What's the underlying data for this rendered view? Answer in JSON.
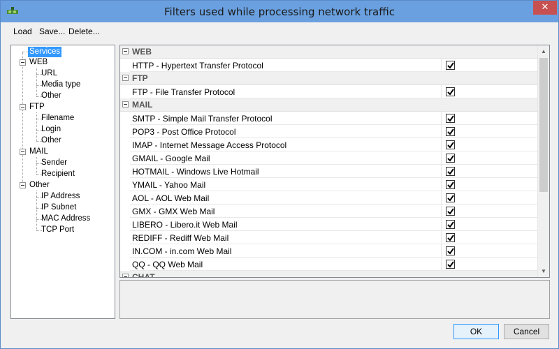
{
  "window": {
    "title": "Filters used while processing network traffic",
    "close_glyph": "✕"
  },
  "menu": {
    "load": "Load",
    "save": "Save...",
    "delete": "Delete..."
  },
  "tree": {
    "services": "Services",
    "web": {
      "label": "WEB",
      "children": [
        "URL",
        "Media type",
        "Other"
      ]
    },
    "ftp": {
      "label": "FTP",
      "children": [
        "Filename",
        "Login",
        "Other"
      ]
    },
    "mail": {
      "label": "MAIL",
      "children": [
        "Sender",
        "Recipient"
      ]
    },
    "other": {
      "label": "Other",
      "children": [
        "IP Address",
        "IP Subnet",
        "MAC Address",
        "TCP Port"
      ]
    }
  },
  "sections": [
    {
      "name": "WEB",
      "rows": [
        {
          "label": "HTTP - Hypertext Transfer Protocol",
          "checked": true
        }
      ]
    },
    {
      "name": "FTP",
      "rows": [
        {
          "label": "FTP - File Transfer Protocol",
          "checked": true
        }
      ]
    },
    {
      "name": "MAIL",
      "rows": [
        {
          "label": "SMTP - Simple Mail Transfer Protocol",
          "checked": true
        },
        {
          "label": "POP3 - Post Office Protocol",
          "checked": true
        },
        {
          "label": "IMAP - Internet Message Access Protocol",
          "checked": true
        },
        {
          "label": "GMAIL - Google Mail",
          "checked": true
        },
        {
          "label": "HOTMAIL - Windows Live Hotmail",
          "checked": true
        },
        {
          "label": "YMAIL - Yahoo Mail",
          "checked": true
        },
        {
          "label": "AOL - AOL Web Mail",
          "checked": true
        },
        {
          "label": "GMX - GMX Web Mail",
          "checked": true
        },
        {
          "label": "LIBERO - Libero.it Web Mail",
          "checked": true
        },
        {
          "label": "REDIFF - Rediff Web Mail",
          "checked": true
        },
        {
          "label": "IN.COM - in.com Web Mail",
          "checked": true
        },
        {
          "label": "QQ - QQ Web Mail",
          "checked": true
        }
      ]
    },
    {
      "name": "CHAT",
      "rows": []
    }
  ],
  "buttons": {
    "ok": "OK",
    "cancel": "Cancel"
  },
  "colors": {
    "titlebar": "#6aa0df",
    "selection": "#3399ff",
    "close": "#c75050"
  }
}
